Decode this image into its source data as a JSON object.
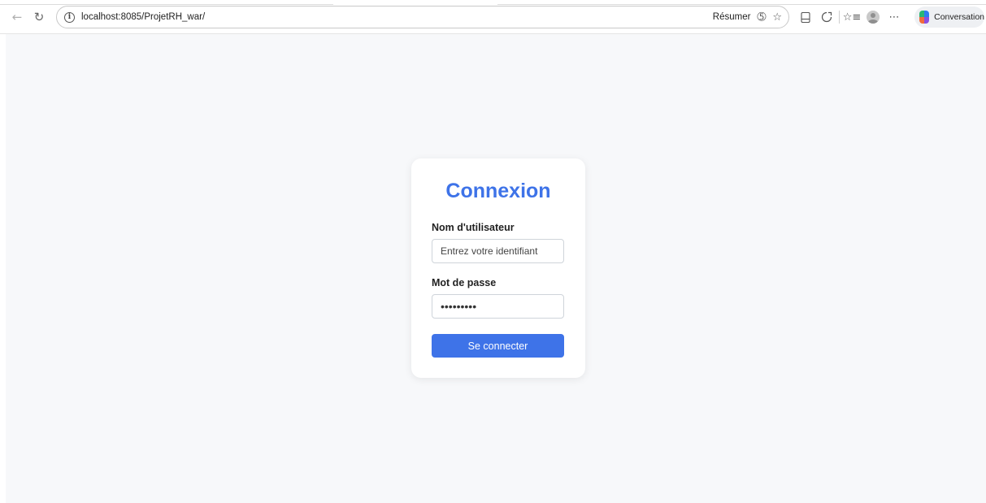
{
  "browser": {
    "url": "localhost:8085/ProjetRH_war/",
    "summarize_label": "Résumer",
    "conversation_label": "Conversation",
    "icons": {
      "back": "arrow-left-icon",
      "reload": "reload-icon",
      "site_info": "info-icon",
      "read_aloud": "read-aloud-icon",
      "favorite": "star-icon",
      "split_screen": "split-screen-icon",
      "extensions": "extensions-icon",
      "favorites_list": "favorites-list-icon",
      "profile": "profile-avatar",
      "more": "more-icon",
      "copilot": "copilot-icon"
    }
  },
  "login": {
    "title": "Connexion",
    "username_label": "Nom d'utilisateur",
    "username_placeholder": "Entrez votre identifiant",
    "username_value": "",
    "password_label": "Mot de passe",
    "password_value": "•••••••••",
    "submit_label": "Se connecter"
  },
  "colors": {
    "accent": "#3e73e8",
    "page_background": "#f7f8fa",
    "card_background": "#ffffff"
  }
}
